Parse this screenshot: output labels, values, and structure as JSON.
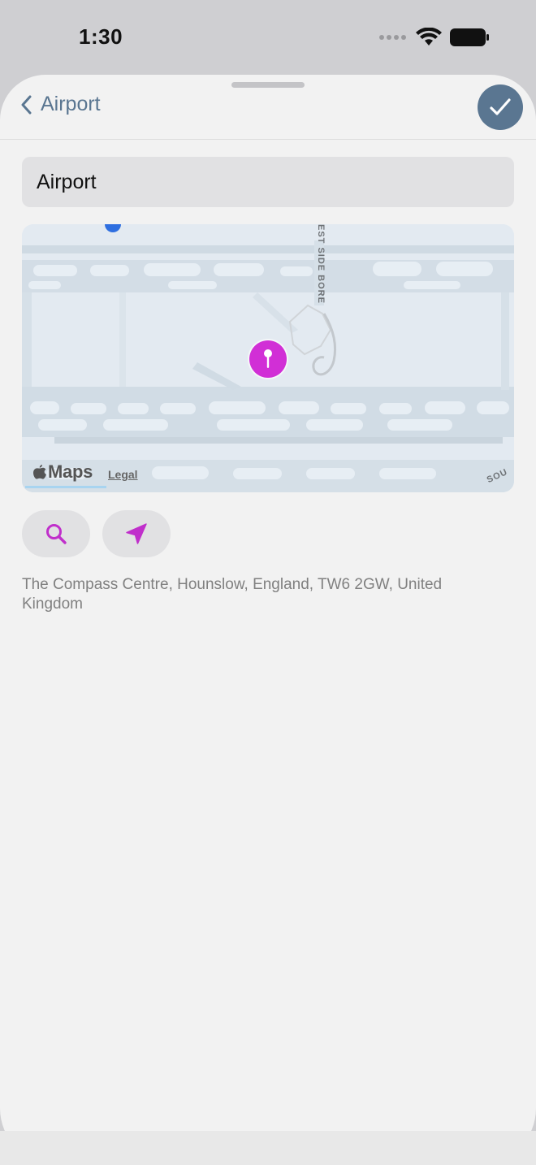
{
  "status_bar": {
    "time": "1:30"
  },
  "nav": {
    "back_label": "Airport"
  },
  "form": {
    "name_value": "Airport"
  },
  "map": {
    "road_label_1": "EST SIDE BORE",
    "road_label_2": "SOU",
    "maps_logo": "Maps",
    "legal_label": "Legal"
  },
  "location": {
    "address": "The Compass Centre, Hounslow, England, TW6 2GW, United Kingdom"
  },
  "colors": {
    "accent": "#5a7691",
    "pin": "#d12fd6",
    "sheet_background": "#f2f2f2",
    "field_background": "#e1e1e3"
  },
  "icons": {
    "back": "chevron-left-icon",
    "done": "checkmark-icon",
    "search": "magnifier-icon",
    "locate": "location-arrow-icon",
    "pin": "map-pin-icon"
  }
}
